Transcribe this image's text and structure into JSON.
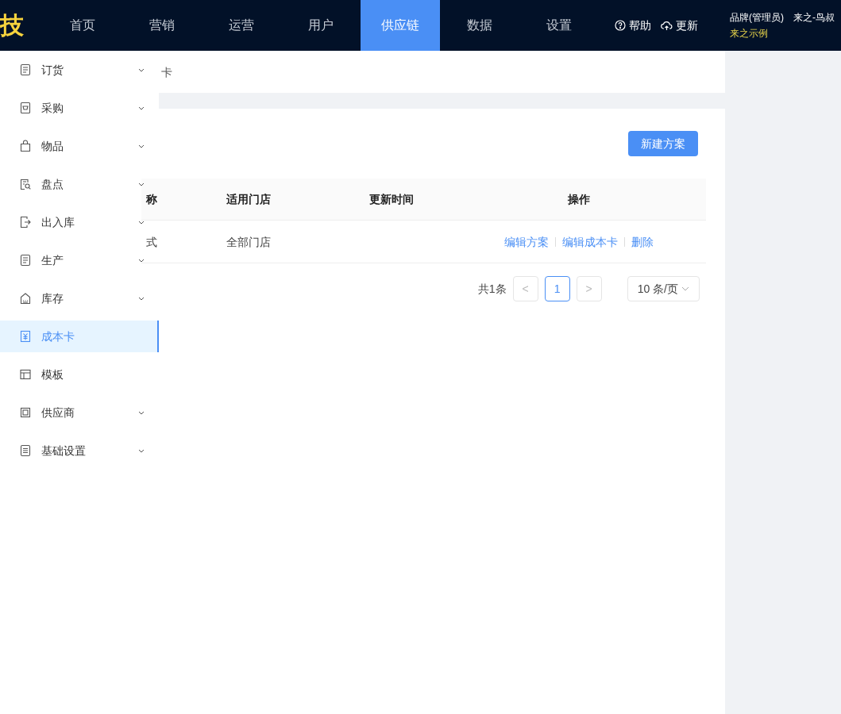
{
  "logo": {
    "text": "技"
  },
  "nav": [
    {
      "label": "首页",
      "selected": false
    },
    {
      "label": "营销",
      "selected": false
    },
    {
      "label": "运营",
      "selected": false
    },
    {
      "label": "用户",
      "selected": false
    },
    {
      "label": "供应链",
      "selected": true
    },
    {
      "label": "数据",
      "selected": false
    },
    {
      "label": "设置",
      "selected": false
    }
  ],
  "header_actions": [
    {
      "kind": "help",
      "label": "帮助"
    },
    {
      "kind": "update",
      "label": "更新"
    }
  ],
  "user": {
    "role": "品牌(管理员)",
    "name": "来之-鸟叔",
    "org": "来之示例"
  },
  "breadcrumb": "卡",
  "new_button": "新建方案",
  "table": {
    "columns": [
      "称",
      "适用门店",
      "更新时间",
      "操作"
    ],
    "rows": [
      {
        "name": "式",
        "stores": "全部门店",
        "updated_at": "",
        "actions": [
          "编辑方案",
          "编辑成本卡",
          "删除"
        ]
      }
    ]
  },
  "pagination": {
    "total": "共1条",
    "prev": "<",
    "pages": [
      {
        "label": "1",
        "selected": true
      }
    ],
    "next": ">",
    "page_size": "10 条/页"
  },
  "sidebar": {
    "items": [
      {
        "label": "订货",
        "expandable": true,
        "selected": false
      },
      {
        "label": "采购",
        "expandable": true,
        "selected": false
      },
      {
        "label": "物品",
        "expandable": true,
        "selected": false
      },
      {
        "label": "盘点",
        "expandable": true,
        "selected": false
      },
      {
        "label": "出入库",
        "expandable": true,
        "selected": false
      },
      {
        "label": "生产",
        "expandable": true,
        "selected": false
      },
      {
        "label": "库存",
        "expandable": true,
        "selected": false
      },
      {
        "label": "成本卡",
        "expandable": false,
        "selected": true
      },
      {
        "label": "模板",
        "expandable": false,
        "selected": false
      },
      {
        "label": "供应商",
        "expandable": true,
        "selected": false
      },
      {
        "label": "基础设置",
        "expandable": true,
        "selected": false
      }
    ]
  }
}
